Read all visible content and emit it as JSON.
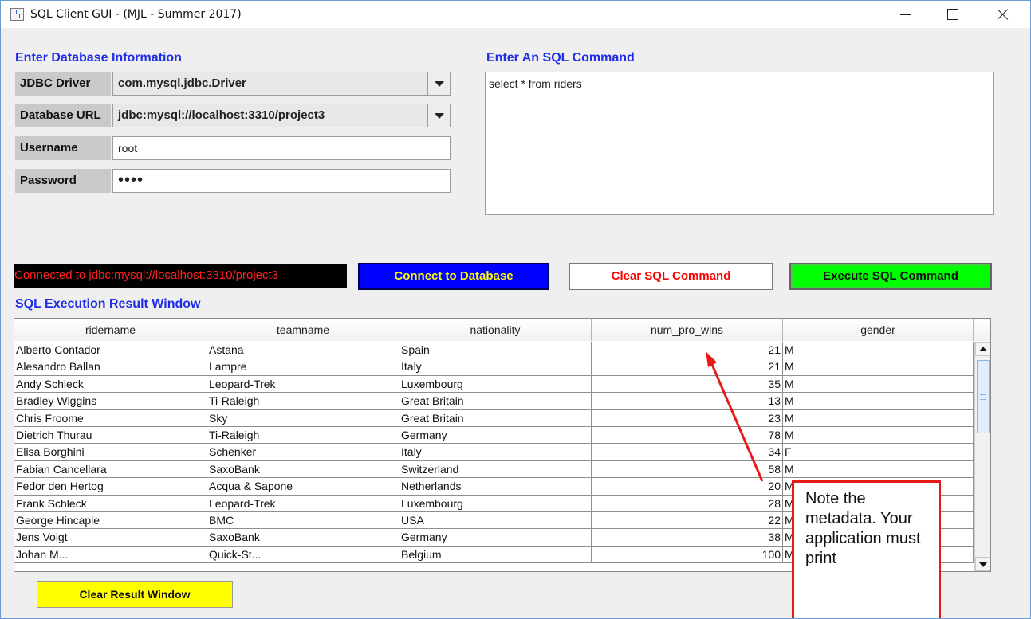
{
  "window": {
    "title": "SQL Client GUI - (MJL - Summer 2017)",
    "controls": [
      "minimize",
      "maximize",
      "close"
    ]
  },
  "db_info": {
    "section_title": "Enter Database Information",
    "jdbc_driver_label": "JDBC Driver",
    "jdbc_driver_value": "com.mysql.jdbc.Driver",
    "database_url_label": "Database URL",
    "database_url_value": "jdbc:mysql://localhost:3310/project3",
    "username_label": "Username",
    "username_value": "root",
    "password_label": "Password",
    "password_value": "••••"
  },
  "sql": {
    "section_title": "Enter An SQL Command",
    "command": "select * from riders"
  },
  "status": {
    "connection_text": "Connected to jdbc:mysql://localhost:3310/project3"
  },
  "buttons": {
    "connect": "Connect to Database",
    "clear_sql": "Clear SQL Command",
    "execute_sql": "Execute SQL Command",
    "clear_result": "Clear Result Window"
  },
  "result": {
    "section_title": "SQL Execution Result Window",
    "columns": [
      "ridername",
      "teamname",
      "nationality",
      "num_pro_wins",
      "gender"
    ],
    "rows": [
      [
        "Alberto Contador",
        "Astana",
        "Spain",
        "21",
        "M"
      ],
      [
        "Alesandro Ballan",
        "Lampre",
        "Italy",
        "21",
        "M"
      ],
      [
        "Andy Schleck",
        "Leopard-Trek",
        "Luxembourg",
        "35",
        "M"
      ],
      [
        "Bradley Wiggins",
        "Ti-Raleigh",
        "Great Britain",
        "13",
        "M"
      ],
      [
        "Chris Froome",
        "Sky",
        "Great Britain",
        "23",
        "M"
      ],
      [
        "Dietrich Thurau",
        "Ti-Raleigh",
        "Germany",
        "78",
        "M"
      ],
      [
        "Elisa Borghini",
        "Schenker",
        "Italy",
        "34",
        "F"
      ],
      [
        "Fabian Cancellara",
        "SaxoBank",
        "Switzerland",
        "58",
        "M"
      ],
      [
        "Fedor den Hertog",
        "Acqua & Sapone",
        "Netherlands",
        "20",
        "M"
      ],
      [
        "Frank Schleck",
        "Leopard-Trek",
        "Luxembourg",
        "28",
        "M"
      ],
      [
        "George Hincapie",
        "BMC",
        "USA",
        "22",
        "M"
      ],
      [
        "Jens Voigt",
        "SaxoBank",
        "Germany",
        "38",
        "M"
      ],
      [
        "Johan M...",
        "Quick-St...",
        "Belgium",
        "100",
        "M"
      ]
    ]
  },
  "annotation": {
    "note_text": "Note the metadata. Your application must print"
  },
  "colors": {
    "section_title": "#1f2de8",
    "connect_bg": "#0000ff",
    "connect_text": "#ffff00",
    "clear_sql_text": "#ff0000",
    "execute_bg": "#00ff00",
    "clear_result_bg": "#ffff00",
    "status_bg": "#000000",
    "status_text": "#ff2020",
    "annotation_red": "#e61919"
  }
}
